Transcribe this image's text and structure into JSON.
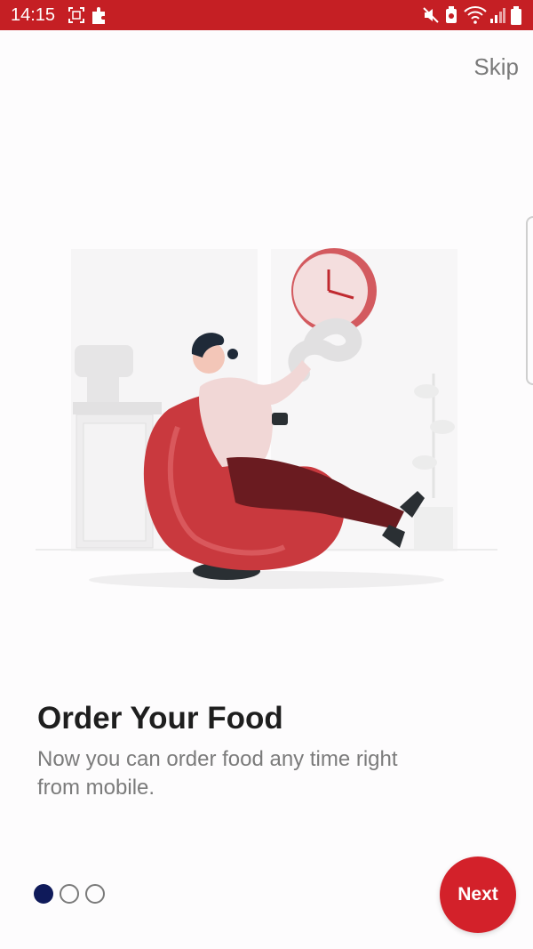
{
  "status_bar": {
    "time": "14:15",
    "icons": [
      "screenshot-icon",
      "puzzle-icon",
      "mute-icon",
      "battery-saver-icon",
      "wifi-icon",
      "signal-icon",
      "battery-icon"
    ],
    "bg_color": "#c51f24"
  },
  "header": {
    "skip_label": "Skip"
  },
  "onboarding": {
    "title": "Order Your Food",
    "description": "Now you can order food any time right from mobile.",
    "illustration": "man-relaxing-in-armchair-illustration"
  },
  "pager": {
    "current_page": 1,
    "total_pages": 3
  },
  "footer": {
    "next_label": "Next"
  },
  "colors": {
    "accent": "#d3212a",
    "active_dot": "#0f1a5a",
    "title": "#1e1e1e",
    "body_text": "#7b7b7b"
  }
}
